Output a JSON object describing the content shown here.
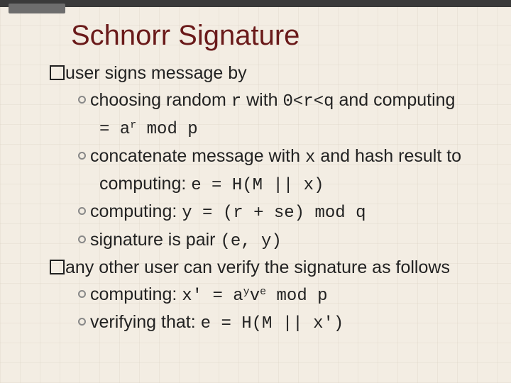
{
  "slide": {
    "title": "Schnorr Signature",
    "p1": {
      "lead": "user signs message by",
      "b1a": "choosing random ",
      "b1b": " with ",
      "b1c": "  and computing",
      "b1d": " mod p",
      "b2a": "concatenate message with ",
      "b2b": " and hash result to",
      "b2c": "computing: ",
      "b2d": "e = H(M || x)",
      "b3a": "computing: ",
      "b3b": "y = (r + se) mod q",
      "b4a": "signature is pair ",
      "b4b": "(e, y)"
    },
    "p2": {
      "lead": "any other user can verify the signature as follows",
      "b1a": "computing: ",
      "b1b": "x' = a",
      "b1c": "y",
      "b1d": "v",
      "b1e": "e",
      "b1f": " mod p",
      "b2a": "verifying that: ",
      "b2b": "e = H(M || x')"
    },
    "code": {
      "r": "r",
      "range": "0<r<q",
      "eqa": "= a",
      "sup_r": "r",
      "x": "x"
    }
  }
}
